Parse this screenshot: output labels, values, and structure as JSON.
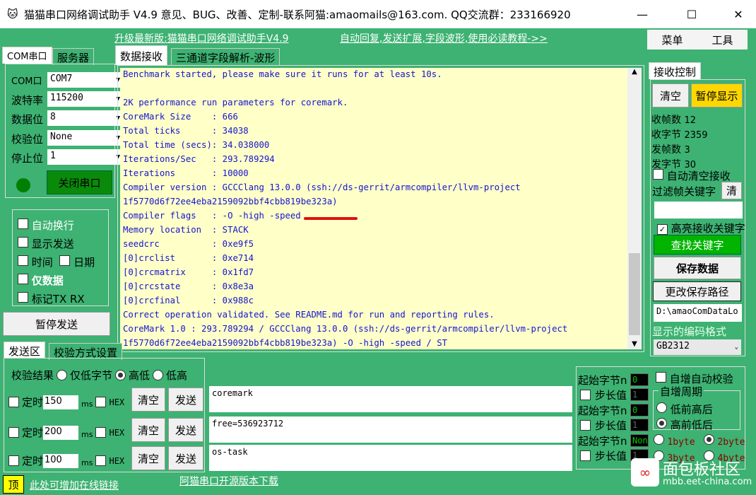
{
  "window": {
    "title": "猫猫串口网络调试助手 V4.9 意见、BUG、改善、定制-联系阿猫:amaomails@163.com. QQ交流群：233166920",
    "minimize": "—",
    "maximize": "☐",
    "close": "✕"
  },
  "links": {
    "upgrade": "升级最新版:猫猫串口网络调试助手V4.9",
    "tutorial": "自动回复,发送扩展,字段波形,使用必读教程->>",
    "add_link": "此处可增加在线链接",
    "opensource": "阿猫串口开源版本下载"
  },
  "menu": {
    "menu": "菜单",
    "tools": "工具"
  },
  "left_tabs": [
    {
      "label": "COM串口",
      "active": true
    },
    {
      "label": "服务器",
      "active": false
    }
  ],
  "serial": {
    "fields": [
      {
        "label": "COM口",
        "value": "COM7"
      },
      {
        "label": "波特率",
        "value": "115200"
      },
      {
        "label": "数据位",
        "value": "8"
      },
      {
        "label": "校验位",
        "value": "None"
      },
      {
        "label": "停止位",
        "value": "1"
      }
    ],
    "close_port": "关闭串口",
    "status_color": "#008000"
  },
  "options": {
    "auto_wrap": "自动换行",
    "show_send": "显示发送",
    "time": "时间",
    "date": "日期",
    "data_only": "仅数据",
    "mark_txrx": "标记TX RX"
  },
  "pause_send": "暂停发送",
  "center_tabs": [
    {
      "label": "数据接收",
      "active": true
    },
    {
      "label": "三通道字段解析-波形",
      "active": false
    }
  ],
  "receive_lines": [
    "Benchmark started, please make sure it runs for at least 10s.",
    "",
    "2K performance run parameters for coremark.",
    "CoreMark Size    : 666",
    "Total ticks      : 34038",
    "Total time (secs): 34.038000",
    "Iterations/Sec   : 293.789294",
    "Iterations       : 10000",
    "Compiler version : GCCClang 13.0.0 (ssh://ds-gerrit/armcompiler/llvm-project",
    "1f5770d6f72ee4eba2159092bbf4cbb819be323a)",
    "Compiler flags   : -O -high -speed",
    "Memory location  : STACK",
    "seedcrc          : 0xe9f5",
    "[0]crclist       : 0xe714",
    "[0]crcmatrix     : 0x1fd7",
    "[0]crcstate      : 0x8e3a",
    "[0]crcfinal      : 0x988c",
    "Correct operation validated. See README.md for run and reporting rules.",
    "CoreMark 1.0 : 293.789294 / GCCClang 13.0.0 (ssh://ds-gerrit/armcompiler/llvm-project",
    "1f5770d6f72ee4eba2159092bbf4cbb819be323a) -O -high -speed / ST"
  ],
  "recv_ctrl": {
    "tab": "接收控制",
    "clear": "清空",
    "pause_display": "暂停显示",
    "rx_frames_label": "收帧数",
    "rx_frames": "12",
    "rx_bytes_label": "收字节",
    "rx_bytes": "2359",
    "tx_frames_label": "发帧数",
    "tx_frames": "3",
    "tx_bytes_label": "发字节",
    "tx_bytes": "30",
    "auto_clear": "自动清空接收",
    "filter_label": "过滤帧关键字",
    "filter_clear": "清",
    "filter_value": "",
    "highlight": "高亮接收关键字",
    "find_keyword": "查找关键字",
    "save_data": "保存数据",
    "change_path": "更改保存路径",
    "path": "D:\\amaoComDataLo",
    "encoding_label": "显示的编码格式",
    "encoding": "GB2312"
  },
  "send_tabs": [
    {
      "label": "发送区",
      "active": true
    },
    {
      "label": "校验方式设置",
      "active": false
    }
  ],
  "checksum": {
    "label": "校验结果",
    "opts": [
      {
        "label": "仅低字节",
        "checked": false
      },
      {
        "label": "高低",
        "checked": true
      },
      {
        "label": "低高",
        "checked": false
      }
    ]
  },
  "send_rows": [
    {
      "timer_label": "定时",
      "interval": "150",
      "unit": "ms",
      "hex": "HEX",
      "clear": "清空",
      "send": "发送",
      "text": "coremark"
    },
    {
      "timer_label": "定时",
      "interval": "200",
      "unit": "ms",
      "hex": "HEX",
      "clear": "清空",
      "send": "发送",
      "text": "free=536923712"
    },
    {
      "timer_label": "定时",
      "interval": "100",
      "unit": "ms",
      "hex": "HEX",
      "clear": "清空",
      "send": "发送",
      "text": "os-task"
    }
  ],
  "incr": {
    "start_label": "起始字节n",
    "step_label": "步长值",
    "rows": [
      {
        "start": "0",
        "step": "1"
      },
      {
        "start": "0",
        "step": "1"
      },
      {
        "start": "Non",
        "step": "1"
      }
    ],
    "auto_check": "自增自动校验",
    "period": "自增周期",
    "low_first": "低前高后",
    "high_first": "高前低后",
    "bytes": [
      {
        "label": "1byte",
        "checked": false
      },
      {
        "label": "2byte",
        "checked": true
      },
      {
        "label": "3byte",
        "checked": false
      },
      {
        "label": "4byte",
        "checked": false
      }
    ]
  },
  "top_button": "顶",
  "watermark": {
    "name": "面包板社区",
    "url": "mbb.eet-china.com"
  }
}
